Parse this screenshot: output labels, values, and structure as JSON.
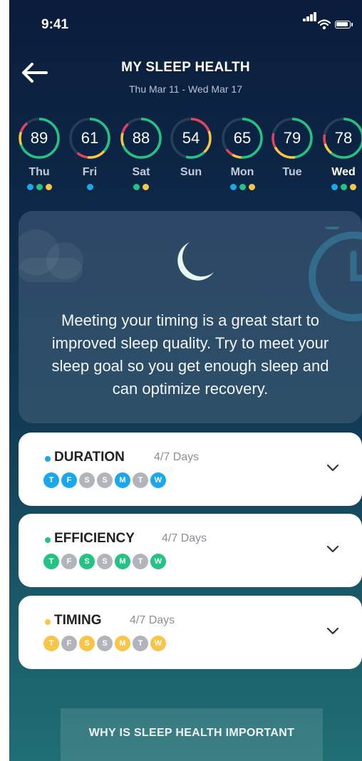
{
  "status_bar": {
    "time": "9:41",
    "icons": [
      "signal-icon",
      "wifi-icon",
      "battery-icon"
    ]
  },
  "header": {
    "title": "MY SLEEP HEALTH",
    "date_range": "Thu Mar 11 - Wed Mar 17",
    "back_icon": "arrow-left-icon"
  },
  "colors": {
    "duration": "#1aa7ec",
    "efficiency": "#23c384",
    "timing": "#f8c547",
    "low": "#e0435e",
    "inactive": "#b1b4bb"
  },
  "days": [
    {
      "name": "Thu",
      "score": "89",
      "score_value": 89,
      "dots": [
        "duration",
        "efficiency",
        "timing"
      ],
      "active": false
    },
    {
      "name": "Fri",
      "score": "61",
      "score_value": 61,
      "dots": [
        "duration"
      ],
      "active": false
    },
    {
      "name": "Sat",
      "score": "88",
      "score_value": 88,
      "dots": [
        "efficiency",
        "timing"
      ],
      "active": false
    },
    {
      "name": "Sun",
      "score": "54",
      "score_value": 54,
      "dots": [],
      "active": false
    },
    {
      "name": "Mon",
      "score": "65",
      "score_value": 65,
      "dots": [
        "duration",
        "efficiency",
        "timing"
      ],
      "active": false
    },
    {
      "name": "Tue",
      "score": "79",
      "score_value": 79,
      "dots": [],
      "active": false
    },
    {
      "name": "Wed",
      "score": "78",
      "score_value": 78,
      "dots": [
        "duration",
        "efficiency",
        "timing"
      ],
      "active": true
    }
  ],
  "info_card": {
    "icons": [
      "cloud-icon",
      "moon-icon",
      "clock-icon"
    ],
    "message": "Meeting your timing is a great start to improved sleep quality. Try to meet your sleep goal so you get enough sleep and can optimize recovery."
  },
  "metrics": [
    {
      "key": "duration",
      "label": "DURATION",
      "count": "4/7 Days",
      "days": [
        {
          "letter": "T",
          "met": true
        },
        {
          "letter": "F",
          "met": true
        },
        {
          "letter": "S",
          "met": false
        },
        {
          "letter": "S",
          "met": false
        },
        {
          "letter": "M",
          "met": true
        },
        {
          "letter": "T",
          "met": false
        },
        {
          "letter": "W",
          "met": true
        }
      ]
    },
    {
      "key": "efficiency",
      "label": "EFFICIENCY",
      "count": "4/7 Days",
      "days": [
        {
          "letter": "T",
          "met": true
        },
        {
          "letter": "F",
          "met": false
        },
        {
          "letter": "S",
          "met": true
        },
        {
          "letter": "S",
          "met": false
        },
        {
          "letter": "M",
          "met": true
        },
        {
          "letter": "T",
          "met": false
        },
        {
          "letter": "W",
          "met": true
        }
      ]
    },
    {
      "key": "timing",
      "label": "TIMING",
      "count": "4/7 Days",
      "days": [
        {
          "letter": "T",
          "met": true
        },
        {
          "letter": "F",
          "met": false
        },
        {
          "letter": "S",
          "met": true
        },
        {
          "letter": "S",
          "met": false
        },
        {
          "letter": "M",
          "met": true
        },
        {
          "letter": "T",
          "met": false
        },
        {
          "letter": "W",
          "met": true
        }
      ]
    }
  ],
  "footer": {
    "button_label": "WHY IS SLEEP HEALTH IMPORTANT"
  }
}
